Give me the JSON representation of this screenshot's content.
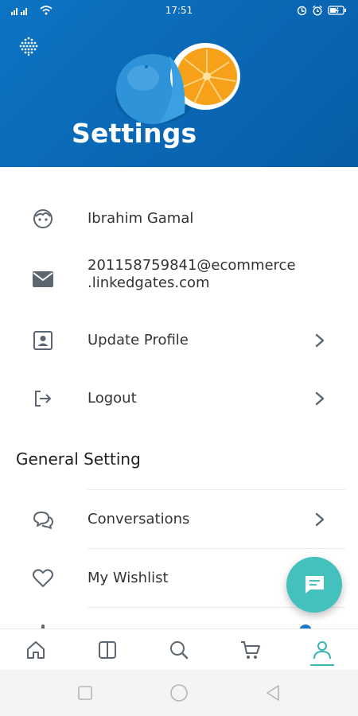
{
  "status_bar": {
    "time": "17:51"
  },
  "header": {
    "title": "Settings"
  },
  "profile": {
    "name": "Ibrahim Gamal",
    "email_line1": "201158759841@ecommerce",
    "email_line2": ".linkedgates.com",
    "update_profile_label": "Update Profile",
    "logout_label": "Logout"
  },
  "general": {
    "section_title": "General Setting",
    "conversations_label": "Conversations",
    "wishlist_label": "My Wishlist"
  },
  "colors": {
    "header_bg": "#0a6ab8",
    "accent": "#45c1bd",
    "icon": "#5c6670"
  },
  "bottom_nav": {
    "items": [
      "home-icon",
      "categories-icon",
      "search-icon",
      "cart-icon",
      "profile-icon"
    ],
    "active": "profile-icon"
  }
}
